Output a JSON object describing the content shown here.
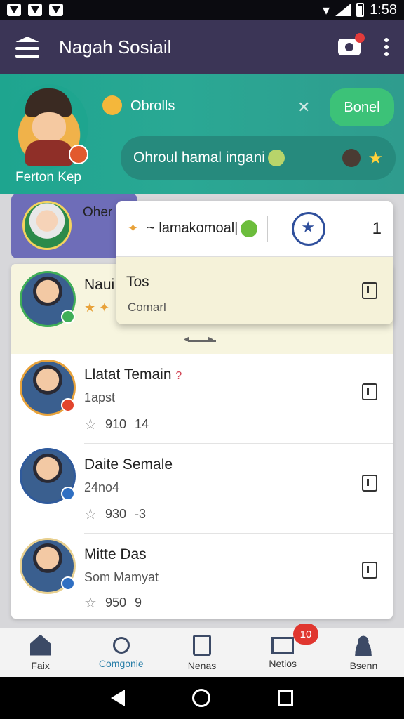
{
  "status_bar": {
    "time": "1:58"
  },
  "app_bar": {
    "title": "Nagah Sosiail"
  },
  "hero": {
    "profile_name": "Ferton Kep",
    "chat_label": "Obrolls",
    "done_label": "Bonel",
    "status_text": "Ohroul hamal ingani"
  },
  "contact_peek": {
    "label": "Oher"
  },
  "popup": {
    "top_label": "~ lamakomoal|",
    "count": "1",
    "title": "Tos",
    "subtitle": "Comarl"
  },
  "rows": [
    {
      "name": "Naui",
      "sub": "★ ✦"
    },
    {
      "name": "Llatat Temain",
      "name_mark": "?",
      "sub": "1apst",
      "stat_a": "910",
      "stat_b": "14"
    },
    {
      "name": "Daite Semale",
      "sub": "24no4",
      "stat_a": "930",
      "stat_b": "-3"
    },
    {
      "name": "Mitte Das",
      "sub": "Som Mamyat",
      "stat_a": "950",
      "stat_b": "9"
    }
  ],
  "bottom_nav": {
    "items": [
      {
        "label": "Faix",
        "icon": "home-icon"
      },
      {
        "label": "Comgonie",
        "icon": "search-icon"
      },
      {
        "label": "Nenas",
        "icon": "document-icon"
      },
      {
        "label": "Netios",
        "icon": "mail-icon"
      },
      {
        "label": "Bsenn",
        "icon": "person-icon"
      }
    ],
    "badge": "10"
  },
  "colors": {
    "app_bar": "#3b3556",
    "hero": "#1ea58f",
    "done": "#3cc278",
    "active_nav": "#2a7fa8"
  }
}
